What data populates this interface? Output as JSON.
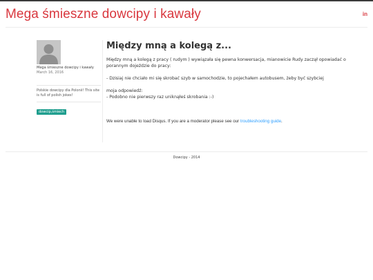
{
  "header": {
    "site_title": "Mega śmieszne dowcipy i kawały",
    "social_label": "in",
    "social_icon": "linkedin-icon",
    "accent_color": "#d9383f"
  },
  "sidebar": {
    "avatar_icon": "default-user-avatar-icon",
    "author_name": "Mega śmieszne dowcipy i kawały",
    "date": "March 16, 2016",
    "description": "Polskie dowcipy dla Polonii! This site is full of polish jokes!",
    "tag": "dowcip,śmiech",
    "tag_color": "#1f9e8e"
  },
  "post": {
    "title": "Między mną a kolegą z...",
    "paragraphs": [
      "Między mną a kolegą z pracy ( rudym ) wywiązała się pewna konwersacja, mianowicie Rudy zaczął opowiadać o porannym dojeździe do pracy:",
      "- Dzisiaj nie chciało mi się skrobać szyb w samochodzie, to pojechałem autobusem, żeby być szybciej",
      "moja odpowiedź:",
      "- Podobno nie pierwszy raz uniknąłeś skrobania :-)"
    ]
  },
  "disqus": {
    "message": "We were unable to load Disqus. If you are a moderator please see our ",
    "link_text": "troubleshooting guide",
    "suffix": "."
  },
  "footer": {
    "text": "Dowcipy - 2014"
  }
}
